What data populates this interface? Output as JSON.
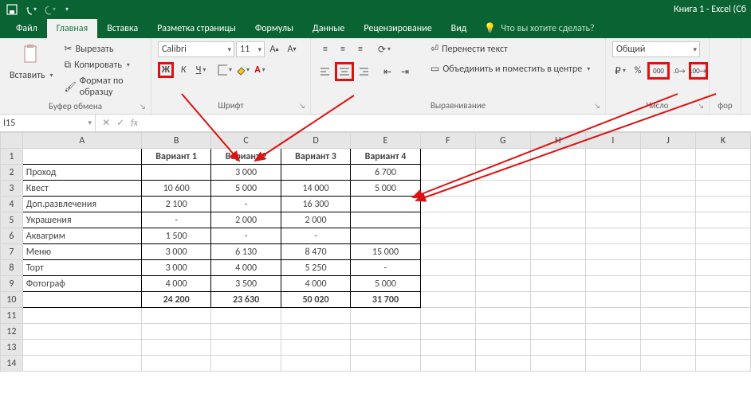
{
  "app": {
    "title": "Книга 1 - Excel (Сб"
  },
  "tabs": {
    "file": "Файл",
    "home": "Главная",
    "insert": "Вставка",
    "layout": "Разметка страницы",
    "formulas": "Формулы",
    "data": "Данные",
    "review": "Рецензирование",
    "view": "Вид",
    "tellme": "Что вы хотите сделать?"
  },
  "ribbon": {
    "clipboard": {
      "paste": "Вставить",
      "cut": "Вырезать",
      "copy": "Копировать",
      "painter": "Формат по образцу",
      "title": "Буфер обмена"
    },
    "font": {
      "name": "Calibri",
      "size": "11",
      "bold": "Ж",
      "italic": "К",
      "underline": "Ч",
      "title": "Шрифт"
    },
    "align": {
      "wrap": "Перенести текст",
      "merge": "Объединить и поместить в центре",
      "title": "Выравнивание"
    },
    "number": {
      "format": "Общий",
      "thousands": "000",
      "inc": "↑0",
      "dec": "↓0",
      "title": "Число",
      "fortitle": "фор"
    }
  },
  "fbar": {
    "name": "I15",
    "fx": "fx"
  },
  "cols": [
    "A",
    "B",
    "C",
    "D",
    "E",
    "F",
    "G",
    "H",
    "I",
    "J",
    "K"
  ],
  "rows": [
    "1",
    "2",
    "3",
    "4",
    "5",
    "6",
    "7",
    "8",
    "9",
    "10",
    "11",
    "12",
    "13",
    "14"
  ],
  "table": {
    "hdr": [
      "",
      "Вариант 1",
      "Вариант 2",
      "Вариант 3",
      "Вариант 4"
    ],
    "r2": [
      "Проход",
      "",
      "3 000",
      "",
      "6 700"
    ],
    "r3": [
      "Квест",
      "10 600",
      "5 000",
      "14 000",
      "5 000"
    ],
    "r4": [
      "Доп.развлечения",
      "2 100",
      "-",
      "16 300",
      ""
    ],
    "r5": [
      "Украшения",
      "-",
      "2 000",
      "2 000",
      ""
    ],
    "r6": [
      "Аквагрим",
      "1 500",
      "-",
      "-",
      ""
    ],
    "r7": [
      "Меню",
      "3 000",
      "6 130",
      "8 470",
      "15 000"
    ],
    "r8": [
      "Торт",
      "3 000",
      "4 000",
      "5 250",
      "-"
    ],
    "r9": [
      "Фотограф",
      "4 000",
      "3 500",
      "4 000",
      "5 000"
    ],
    "r10": [
      "",
      "24 200",
      "23 630",
      "50 020",
      "31 700"
    ]
  }
}
